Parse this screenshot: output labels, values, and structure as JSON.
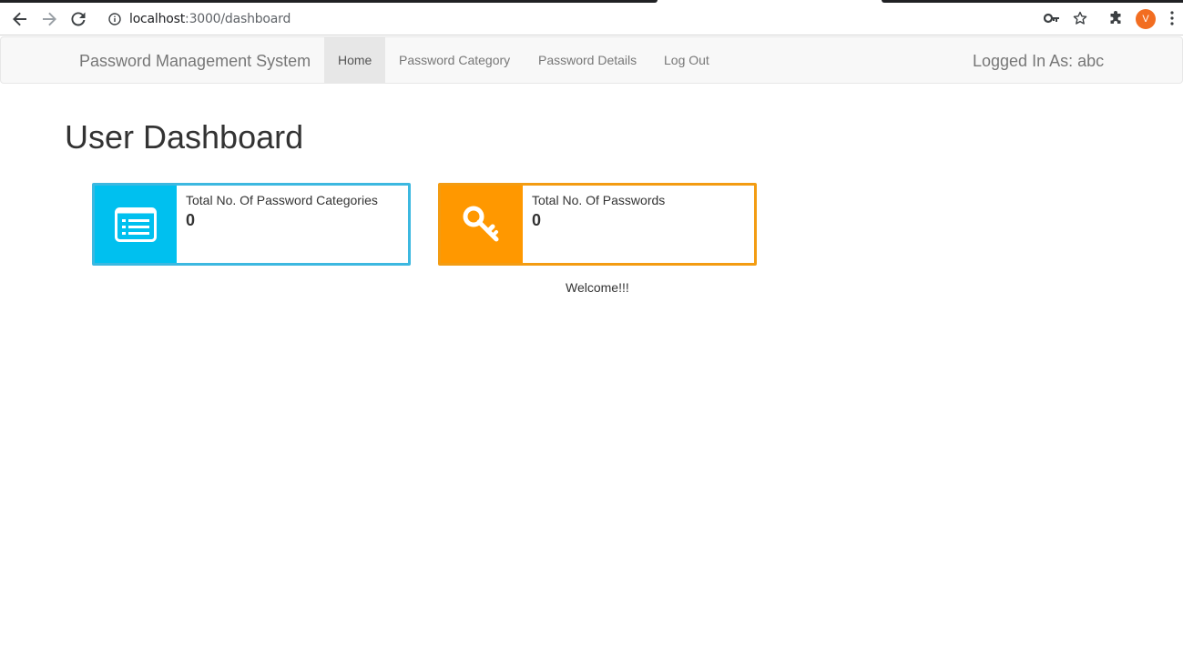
{
  "browser": {
    "url_host": "localhost",
    "url_path": ":3000/dashboard",
    "avatar_letter": "V"
  },
  "navbar": {
    "brand": "Password Management System",
    "items": [
      {
        "label": "Home",
        "active": true
      },
      {
        "label": "Password Category",
        "active": false
      },
      {
        "label": "Password Details",
        "active": false
      },
      {
        "label": "Log Out",
        "active": false
      }
    ],
    "logged_in": "Logged In As: abc"
  },
  "main": {
    "title": "User Dashboard",
    "boxes": [
      {
        "label": "Total No. Of Password Categories",
        "value": "0",
        "icon": "list-icon",
        "color": "#00c0ef"
      },
      {
        "label": "Total No. Of Passwords",
        "value": "0",
        "icon": "key-icon",
        "color": "#ff9800"
      }
    ],
    "welcome": "Welcome!!!"
  }
}
